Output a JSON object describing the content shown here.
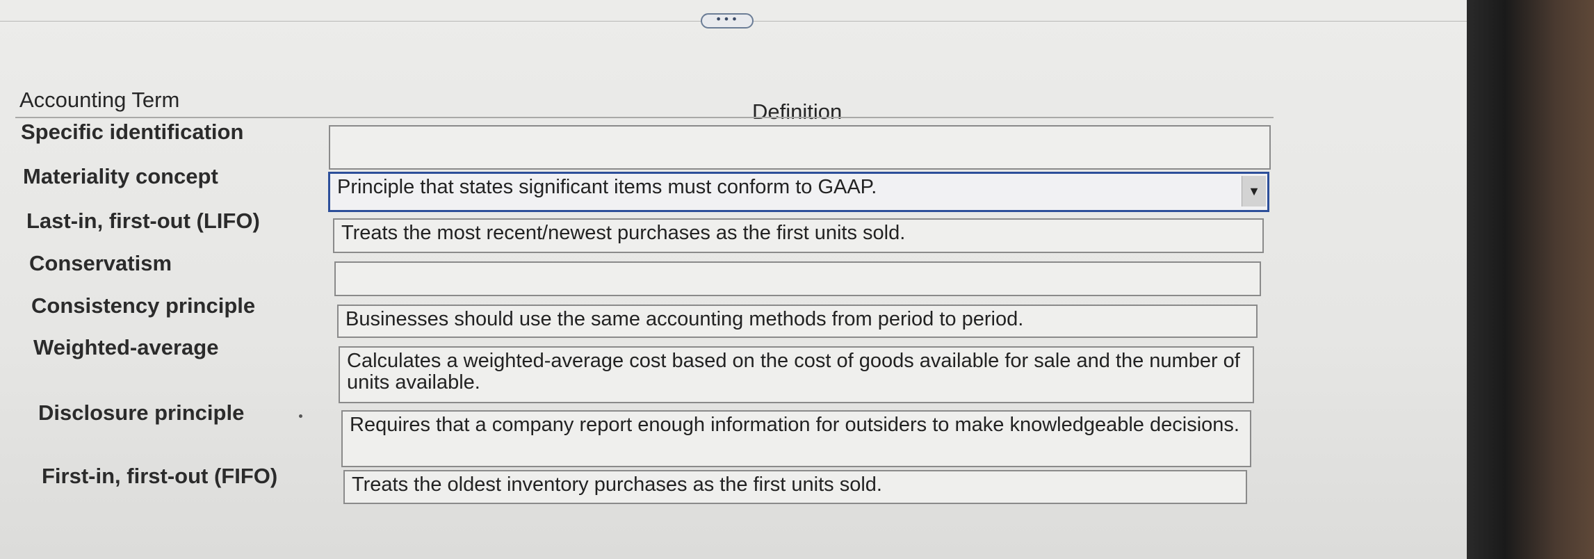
{
  "toolbar": {
    "expand_handle": "•••"
  },
  "table": {
    "header_term": "Accounting Term",
    "header_definition": "Definition",
    "rows": [
      {
        "term": "Specific identification",
        "definition": ""
      },
      {
        "term": "Materiality concept",
        "definition": "Principle that states significant items must conform to GAAP."
      },
      {
        "term": "Last-in, first-out (LIFO)",
        "definition": "Treats the most recent/newest purchases as the first units sold."
      },
      {
        "term": "Conservatism",
        "definition": ""
      },
      {
        "term": "Consistency principle",
        "definition": "Businesses should use the same accounting methods from period to period."
      },
      {
        "term": "Weighted-average",
        "definition": "Calculates a weighted-average cost based on the cost of goods available for sale and the number of units available."
      },
      {
        "term": "Disclosure principle",
        "definition": "Requires that a company report enough information for outsiders to make knowledgeable decisions."
      },
      {
        "term": "First-in, first-out (FIFO)",
        "definition": "Treats the oldest inventory purchases as the first units sold."
      }
    ]
  },
  "dropdown_icon": "caret-down-icon",
  "dropdown_glyph": "▼",
  "colors": {
    "active_border": "#2d4f9a",
    "box_border": "#8a8a8a"
  }
}
